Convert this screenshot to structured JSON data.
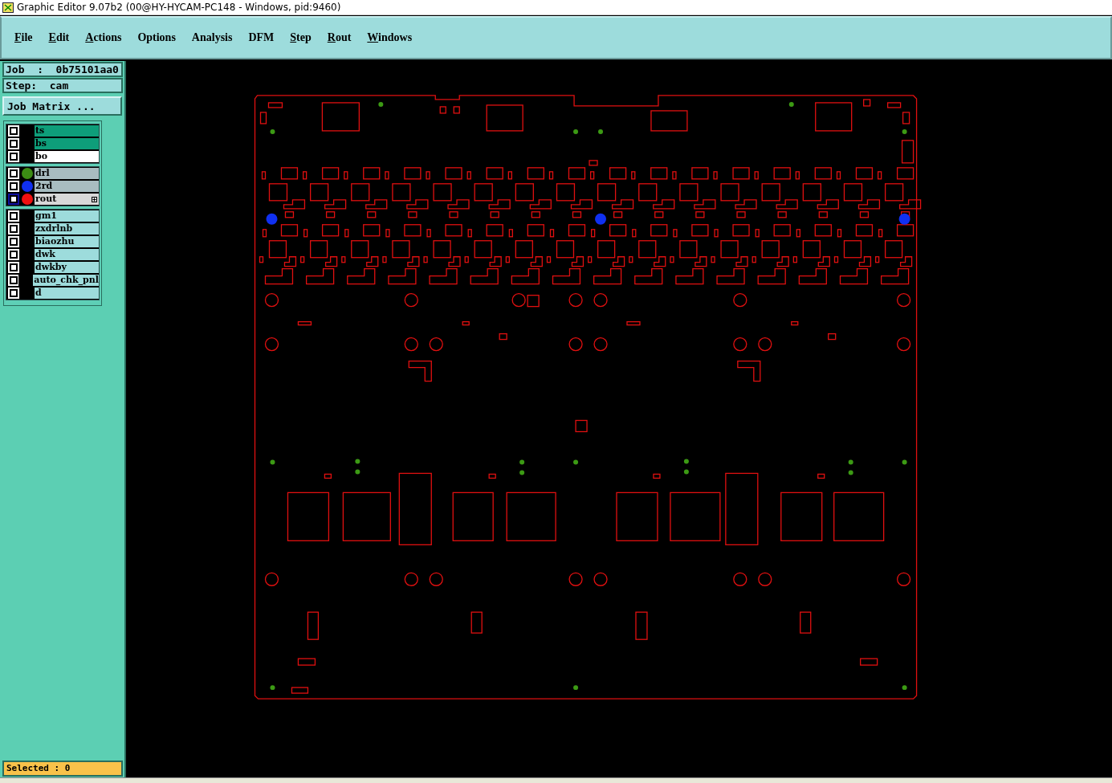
{
  "window": {
    "title": "Graphic Editor 9.07b2 (00@HY-HYCAM-PC148 - Windows, pid:9460)"
  },
  "menu": [
    {
      "label": "File",
      "mnemonic": true
    },
    {
      "label": "Edit",
      "mnemonic": true
    },
    {
      "label": "Actions",
      "mnemonic": true
    },
    {
      "label": "Options",
      "mnemonic": false
    },
    {
      "label": "Analysis",
      "mnemonic": false
    },
    {
      "label": "DFM",
      "mnemonic": false
    },
    {
      "label": "Step",
      "mnemonic": true
    },
    {
      "label": "Rout",
      "mnemonic": true
    },
    {
      "label": "Windows",
      "mnemonic": true
    }
  ],
  "job": "Job  :  0b75101aa0",
  "step": "Step:  cam",
  "job_matrix_button": "Job Matrix ...",
  "layer_groups": [
    {
      "layers": [
        {
          "name": "ts",
          "kind": "board",
          "checked": true,
          "selected": false
        },
        {
          "name": "bs",
          "kind": "board",
          "checked": true,
          "selected": false
        },
        {
          "name": "bo",
          "kind": "outline",
          "checked": true,
          "selected": false
        }
      ]
    },
    {
      "layers": [
        {
          "name": "drl",
          "kind": "drill",
          "color": "#3c8c14",
          "checked": true,
          "selected": false
        },
        {
          "name": "2rd",
          "kind": "drill",
          "color": "#1030f0",
          "checked": true,
          "selected": false
        },
        {
          "name": "rout",
          "kind": "drill",
          "color": "#f01010",
          "checked": true,
          "selected": true
        }
      ]
    },
    {
      "layers": [
        {
          "name": "gm1",
          "kind": "misc",
          "checked": true,
          "selected": false
        },
        {
          "name": "zxdrlnb",
          "kind": "misc",
          "checked": true,
          "selected": false
        },
        {
          "name": "biaozhu",
          "kind": "misc",
          "checked": true,
          "selected": false
        },
        {
          "name": "dwk",
          "kind": "misc",
          "checked": true,
          "selected": false
        },
        {
          "name": "dwkby",
          "kind": "misc",
          "checked": true,
          "selected": false
        },
        {
          "name": "auto_chk_pnl",
          "kind": "misc",
          "checked": true,
          "selected": false
        },
        {
          "name": "d",
          "kind": "misc",
          "checked": true,
          "selected": false
        }
      ]
    }
  ],
  "status": "Selected : 0"
}
